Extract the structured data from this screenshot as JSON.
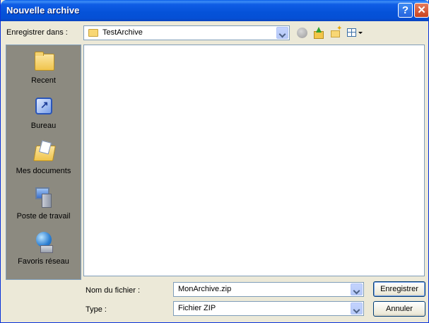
{
  "window": {
    "title": "Nouvelle archive"
  },
  "titlebar_buttons": {
    "help": "?",
    "close": "✕"
  },
  "save_in": {
    "label": "Enregistrer dans :",
    "value": "TestArchive"
  },
  "toolbar_icons": [
    "back-icon",
    "up-folder-icon",
    "new-folder-icon",
    "views-menu-icon"
  ],
  "places": [
    {
      "label": "Recent",
      "icon": "recent-folder-icon"
    },
    {
      "label": "Bureau",
      "icon": "desktop-icon"
    },
    {
      "label": "Mes documents",
      "icon": "my-documents-icon"
    },
    {
      "label": "Poste de travail",
      "icon": "my-computer-icon"
    },
    {
      "label": "Favoris réseau",
      "icon": "network-places-icon"
    }
  ],
  "filename": {
    "label": "Nom du fichier :",
    "value": "MonArchive.zip"
  },
  "filetype": {
    "label": "Type :",
    "value": "Fichier ZIP"
  },
  "buttons": {
    "save": "Enregistrer",
    "cancel": "Annuler"
  },
  "colors": {
    "titlebar": "#0552d8",
    "dialog_bg": "#ece9d8",
    "places_bg": "#8c8a80",
    "field_border": "#7f9db9"
  }
}
